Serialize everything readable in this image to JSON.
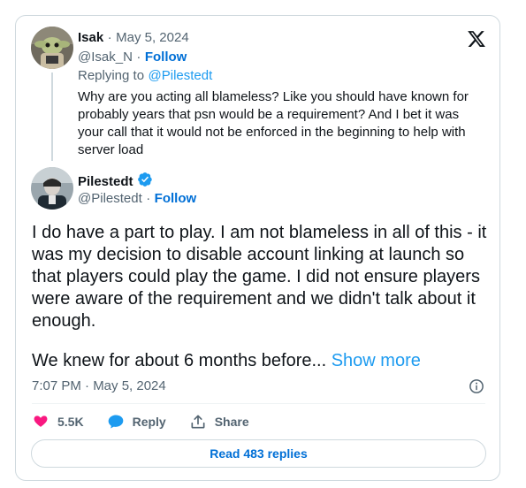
{
  "parent": {
    "name": "Isak",
    "separator": "·",
    "date": "May 5, 2024",
    "handle": "@Isak_N",
    "follow_label": "Follow",
    "replying_prefix": "Replying to",
    "replying_to": "@Pilestedt",
    "text": "Why are you acting all blameless? Like you should have known for probably years that psn would be a requirement? And I bet it was your call that it would not be enforced in the beginning to help with server load"
  },
  "tweet": {
    "name": "Pilestedt",
    "verified": true,
    "handle": "@Pilestedt",
    "separator": "·",
    "follow_label": "Follow",
    "text": "I do have a part to play. I am not blameless in all of this - it was my decision to disable account linking at launch so that players could play the game. I did not ensure players were aware of the requirement and we didn't talk about it enough.",
    "truncated_text": "We knew for about 6 months before...",
    "show_more": "Show more",
    "timestamp": "7:07 PM · May 5, 2024"
  },
  "actions": {
    "likes": "5.5K",
    "reply_label": "Reply",
    "share_label": "Share"
  },
  "read_replies_label": "Read 483 replies",
  "icons": {
    "logo": "x-logo-icon",
    "verified": "verified-badge-icon",
    "info": "info-icon",
    "like": "heart-icon",
    "reply": "reply-bubble-icon",
    "share": "share-icon"
  },
  "colors": {
    "accent": "#1d9bf0",
    "follow": "#006fd6",
    "like": "#f91880",
    "muted": "#536471",
    "border": "#cfd9de"
  }
}
